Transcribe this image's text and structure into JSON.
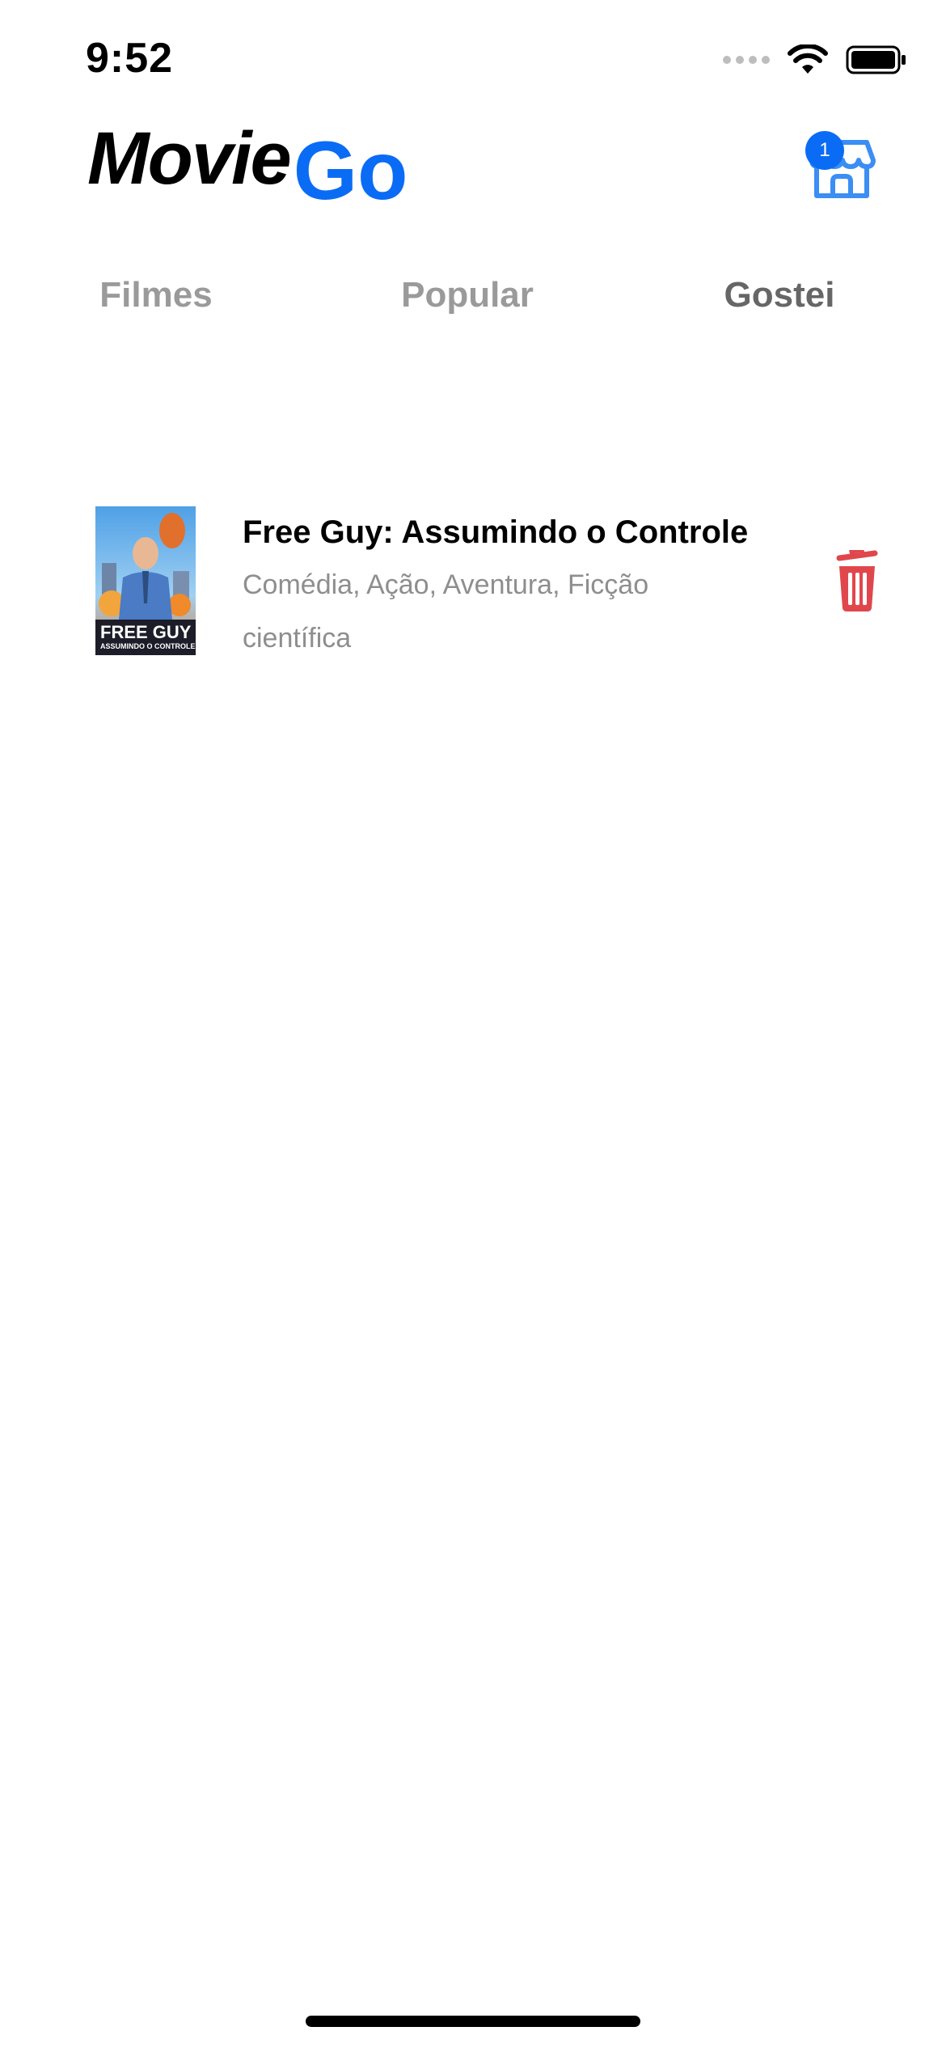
{
  "status_bar": {
    "time": "9:52"
  },
  "header": {
    "logo_part1": "Movie",
    "logo_part2": "Go",
    "cart_badge_count": "1",
    "brand_color": "#0a6cf5"
  },
  "tabs": [
    {
      "label": "Filmes",
      "active": false
    },
    {
      "label": "Popular",
      "active": false
    },
    {
      "label": "Gostei",
      "active": true
    }
  ],
  "liked_movies": [
    {
      "title": "Free Guy: Assumindo o Controle",
      "genres": "Comédia, Ação, Aventura, Ficção científica",
      "poster_text_1": "FREE GUY",
      "poster_text_2": "ASSUMINDO O CONTROLE"
    }
  ],
  "colors": {
    "delete_icon": "#e0474c",
    "tab_inactive": "#9a9a9a",
    "tab_active": "#666666"
  }
}
